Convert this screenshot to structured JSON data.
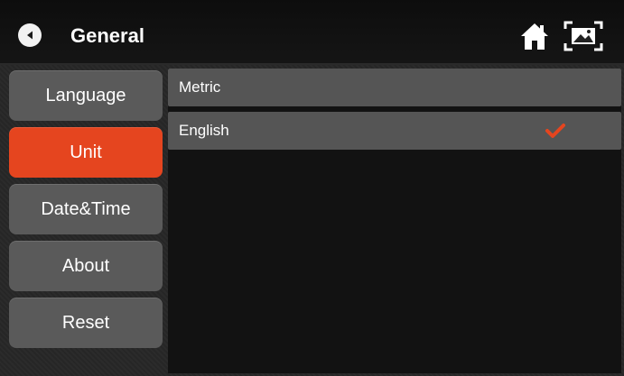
{
  "header": {
    "title": "General",
    "icons": [
      "back-arrow-icon",
      "home-icon",
      "screenshot-icon"
    ]
  },
  "sidebar": {
    "items": [
      {
        "label": "Language",
        "active": false
      },
      {
        "label": "Unit",
        "active": true
      },
      {
        "label": "Date&Time",
        "active": false
      },
      {
        "label": "About",
        "active": false
      },
      {
        "label": "Reset",
        "active": false
      }
    ]
  },
  "unit_panel": {
    "options": [
      {
        "label": "Metric",
        "selected": false
      },
      {
        "label": "English",
        "selected": true
      }
    ]
  },
  "colors": {
    "accent": "#e5451f",
    "button": "#5a5a5a",
    "panel": "#121212",
    "option": "#555555",
    "text": "#ffffff"
  }
}
